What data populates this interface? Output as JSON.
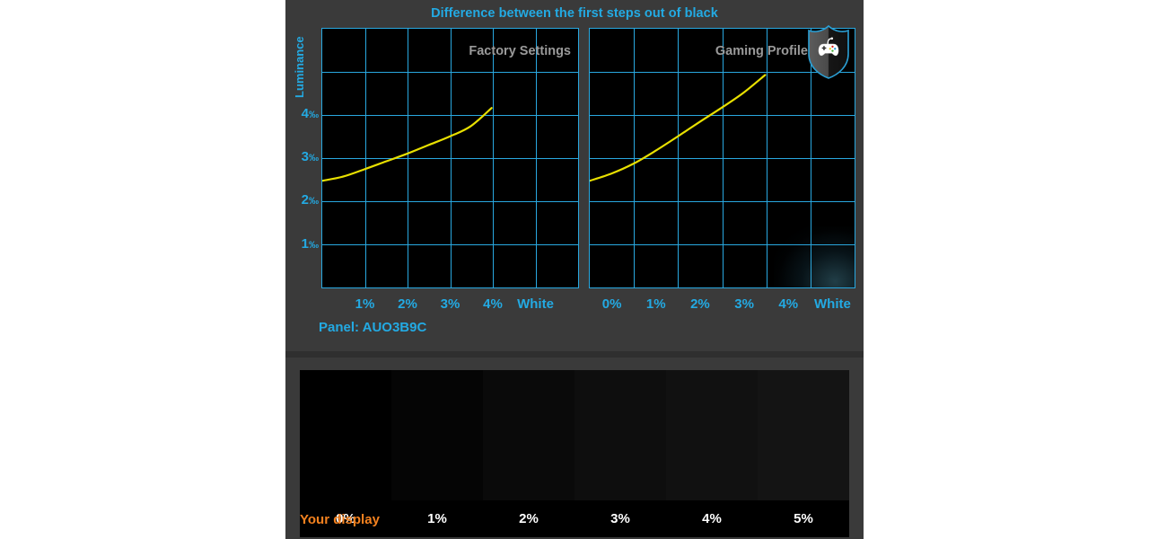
{
  "title": "Difference between the first steps out of black",
  "colors": {
    "accent_cyan": "#23aae3",
    "grid_cyan": "#29a8e0",
    "curve_yellow": "#e8e000",
    "panel_bg": "#3a3a3a",
    "plot_bg": "#000000",
    "label_grey": "#9a9a9a",
    "orange": "#f5821f"
  },
  "y_axis": {
    "title": "Luminance",
    "ticks": [
      {
        "value": 4,
        "label": "4",
        "unit": "‰"
      },
      {
        "value": 3,
        "label": "3",
        "unit": "‰"
      },
      {
        "value": 2,
        "label": "2",
        "unit": "‰"
      },
      {
        "value": 1,
        "label": "1",
        "unit": "‰"
      }
    ]
  },
  "panel_info": "Panel: AUO3B9C",
  "badge": {
    "icon": "shield-gamepad-icon",
    "label": "Gaming Profile Badge"
  },
  "charts": [
    {
      "id": "factory-settings",
      "label": "Factory Settings",
      "x_ticks": [
        "1%",
        "2%",
        "3%",
        "4%",
        "White"
      ]
    },
    {
      "id": "gaming-profile",
      "label": "Gaming Profile",
      "x_ticks": [
        "0%",
        "1%",
        "2%",
        "3%",
        "4%",
        "White"
      ]
    }
  ],
  "gradient_strip": {
    "caption": "Your display",
    "labels": [
      "0%",
      "1%",
      "2%",
      "3%",
      "4%",
      "5%"
    ],
    "swatch_colors": [
      "#000000",
      "#050505",
      "#0a0a0a",
      "#0e0e0e",
      "#111111",
      "#141414"
    ]
  },
  "chart_data": [
    {
      "type": "line",
      "id": "factory-settings",
      "title": "Factory Settings",
      "subtitle": "Difference between the first steps out of black",
      "xlabel": "",
      "ylabel": "Luminance",
      "ylim": [
        0,
        6
      ],
      "yunit": "‰",
      "grid": true,
      "legend": "none",
      "categories": [
        "1%",
        "2%",
        "3%",
        "4%",
        "White"
      ],
      "x": [
        0.0,
        1.0,
        2.0,
        3.0,
        4.0,
        5.0
      ],
      "x_tick_values": [
        1.0,
        2.0,
        3.0,
        4.0,
        5.0
      ],
      "series": [
        {
          "name": "Factory Settings luminance step",
          "color": "#e8e000",
          "x": [
            0.0,
            0.5,
            1.0,
            1.5,
            2.0,
            2.5,
            3.0,
            3.5,
            4.0
          ],
          "values": [
            2.45,
            2.55,
            2.72,
            2.9,
            3.08,
            3.28,
            3.48,
            3.72,
            4.15
          ]
        }
      ]
    },
    {
      "type": "line",
      "id": "gaming-profile",
      "title": "Gaming Profile",
      "subtitle": "Difference between the first steps out of black",
      "xlabel": "",
      "ylabel": "Luminance",
      "ylim": [
        0,
        6
      ],
      "yunit": "‰",
      "grid": true,
      "legend": "none",
      "categories": [
        "0%",
        "1%",
        "2%",
        "3%",
        "4%",
        "White"
      ],
      "x": [
        0.0,
        1.0,
        2.0,
        3.0,
        4.0,
        5.0
      ],
      "x_tick_values": [
        0.0,
        1.0,
        2.0,
        3.0,
        4.0,
        5.0
      ],
      "series": [
        {
          "name": "Gaming Profile luminance step",
          "color": "#e8e000",
          "x": [
            0.0,
            0.5,
            1.0,
            1.5,
            2.0,
            2.5,
            3.0,
            3.5,
            4.0
          ],
          "values": [
            2.45,
            2.62,
            2.85,
            3.15,
            3.48,
            3.82,
            4.15,
            4.5,
            4.92
          ]
        }
      ]
    },
    {
      "type": "heatmap",
      "id": "your-display-strip",
      "title": "Your display",
      "categories": [
        "0%",
        "1%",
        "2%",
        "3%",
        "4%",
        "5%"
      ],
      "values": [
        0,
        1,
        2,
        3,
        4,
        5
      ],
      "colors": [
        "#000000",
        "#050505",
        "#0a0a0a",
        "#0e0e0e",
        "#111111",
        "#141414"
      ]
    }
  ]
}
